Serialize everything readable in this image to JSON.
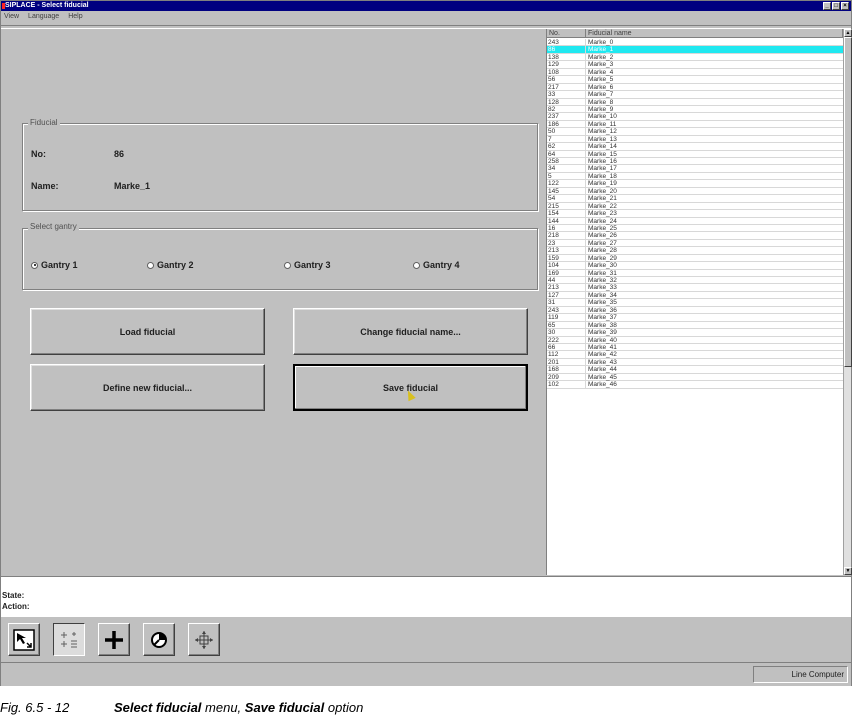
{
  "window": {
    "title": "SIPLACE - Select fiducial",
    "controls": [
      "_",
      "□",
      "×"
    ]
  },
  "menu": [
    "View",
    "Language",
    "Help"
  ],
  "fiducial": {
    "group_label": "Fiducial",
    "no_label": "No:",
    "no_value": "86",
    "name_label": "Name:",
    "name_value": "Marke_1"
  },
  "gantry": {
    "group_label": "Select gantry",
    "options": [
      {
        "label": "Gantry 1",
        "checked": true
      },
      {
        "label": "Gantry 2",
        "checked": false
      },
      {
        "label": "Gantry 3",
        "checked": false
      },
      {
        "label": "Gantry 4",
        "checked": false
      }
    ]
  },
  "buttons": {
    "load": "Load fiducial",
    "change_name": "Change fiducial name...",
    "define_new": "Define new fiducial...",
    "save": "Save fiducial"
  },
  "list": {
    "header_no": "No.",
    "header_name": "Fiducial name",
    "selected_index": 1,
    "rows": [
      [
        "243",
        "Marke_0"
      ],
      [
        "86",
        "Marke_1"
      ],
      [
        "138",
        "Marke_2"
      ],
      [
        "129",
        "Marke_3"
      ],
      [
        "108",
        "Marke_4"
      ],
      [
        "56",
        "Marke_5"
      ],
      [
        "217",
        "Marke_6"
      ],
      [
        "33",
        "Marke_7"
      ],
      [
        "128",
        "Marke_8"
      ],
      [
        "82",
        "Marke_9"
      ],
      [
        "237",
        "Marke_10"
      ],
      [
        "186",
        "Marke_11"
      ],
      [
        "50",
        "Marke_12"
      ],
      [
        "7",
        "Marke_13"
      ],
      [
        "62",
        "Marke_14"
      ],
      [
        "64",
        "Marke_15"
      ],
      [
        "258",
        "Marke_16"
      ],
      [
        "34",
        "Marke_17"
      ],
      [
        "5",
        "Marke_18"
      ],
      [
        "122",
        "Marke_19"
      ],
      [
        "145",
        "Marke_20"
      ],
      [
        "54",
        "Marke_21"
      ],
      [
        "215",
        "Marke_22"
      ],
      [
        "154",
        "Marke_23"
      ],
      [
        "144",
        "Marke_24"
      ],
      [
        "16",
        "Marke_25"
      ],
      [
        "218",
        "Marke_26"
      ],
      [
        "23",
        "Marke_27"
      ],
      [
        "213",
        "Marke_28"
      ],
      [
        "159",
        "Marke_29"
      ],
      [
        "104",
        "Marke_30"
      ],
      [
        "169",
        "Marke_31"
      ],
      [
        "44",
        "Marke_32"
      ],
      [
        "213",
        "Marke_33"
      ],
      [
        "127",
        "Marke_34"
      ],
      [
        "31",
        "Marke_35"
      ],
      [
        "243",
        "Marke_36"
      ],
      [
        "119",
        "Marke_37"
      ],
      [
        "65",
        "Marke_38"
      ],
      [
        "30",
        "Marke_39"
      ],
      [
        "222",
        "Marke_40"
      ],
      [
        "66",
        "Marke_41"
      ],
      [
        "112",
        "Marke_42"
      ],
      [
        "201",
        "Marke_43"
      ],
      [
        "168",
        "Marke_44"
      ],
      [
        "209",
        "Marke_45"
      ],
      [
        "102",
        "Marke_46"
      ]
    ]
  },
  "status": {
    "state_label": "State:",
    "action_label": "Action:"
  },
  "toolbar": {
    "icons": [
      "select-arrow-icon",
      "fiducial-grid-icon",
      "cross-icon",
      "camera-icon",
      "target-move-icon"
    ]
  },
  "statusbar": {
    "mode": "Line Computer"
  },
  "caption": {
    "fig": "Fig. 6.5 - 12",
    "part1": "Select fiducial",
    "part2": " menu, ",
    "part3": "Save fiducial",
    "part4": " option"
  }
}
